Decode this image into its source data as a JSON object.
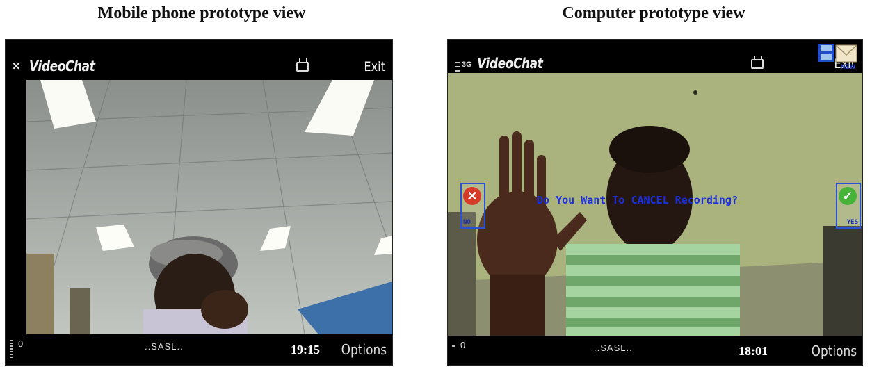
{
  "captions": {
    "left": "Mobile phone prototype view",
    "right": "Computer prototype view"
  },
  "mobile": {
    "title": "VideoChat",
    "exit_label": "Exit",
    "signal_value": "0",
    "operator": "..SASL..",
    "clock": "19:15",
    "options_label": "Options"
  },
  "computer": {
    "network": "3G",
    "title": "VideoChat",
    "exit_label": "Exit",
    "new_label": "NEW",
    "prompt": "Do You Want To CANCEL Recording?",
    "no_label": "NO",
    "yes_label": "YES",
    "signal_value": "0",
    "operator": "..SASL..",
    "clock": "18:01",
    "options_label": "Options"
  },
  "colors": {
    "prompt_text": "#1a2fd8",
    "no_button": "#d83a2a",
    "yes_button": "#46b23a"
  }
}
